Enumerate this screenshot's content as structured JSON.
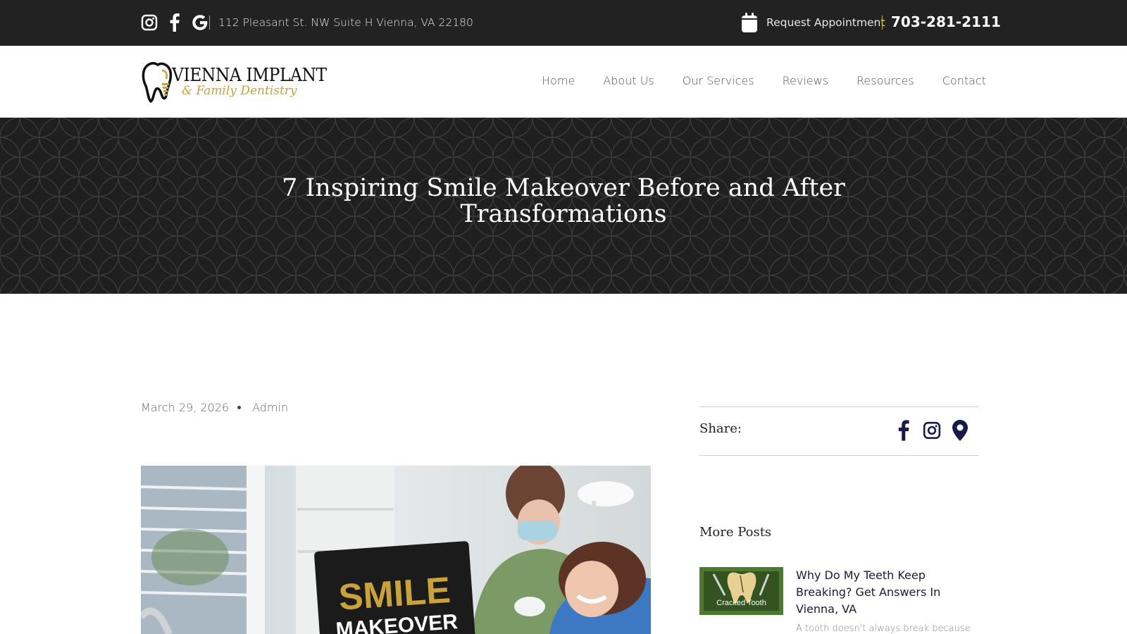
{
  "topbar": {
    "social_icons": [
      "instagram-icon",
      "facebook-icon",
      "google-icon"
    ],
    "address": "112 Pleasant St. NW Suite H Vienna, VA 22180",
    "request_label": "Request Appointment",
    "phone": "703-281-2111",
    "accent_color": "#c9a23a"
  },
  "header": {
    "logo_line1": "VIENNA IMPLANT",
    "logo_line2": "& Family Dentistry",
    "nav": [
      "Home",
      "About Us",
      "Our Services",
      "Reviews",
      "Resources",
      "Contact"
    ]
  },
  "hero": {
    "title": "7 Inspiring Smile Makeover Before and After Transformations"
  },
  "post": {
    "date": "March 29, 2026",
    "author": "Admin",
    "image_sign_line1": "SMILE",
    "image_sign_line2": "MAKEOVER"
  },
  "sidebar": {
    "share_label": "Share:",
    "share_icons": [
      "facebook-icon",
      "instagram-icon",
      "map-pin-icon"
    ],
    "more_posts_title": "More Posts",
    "posts": [
      {
        "thumb_caption": "Cracked Tooth",
        "title": "Why Do My Teeth Keep Breaking? Get Answers In Vienna, VA",
        "excerpt": "A tooth doesn't always break because"
      }
    ]
  }
}
